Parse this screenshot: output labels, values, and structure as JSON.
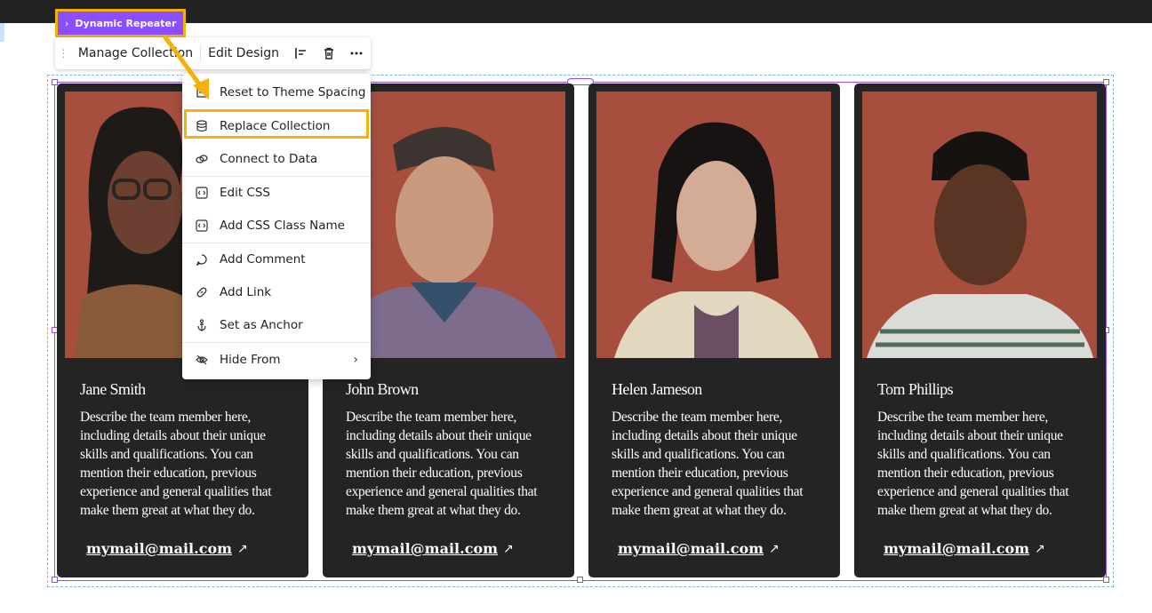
{
  "element_tag": {
    "label": "Dynamic Repeater",
    "chevron": "›"
  },
  "toolbar": {
    "manage_label": "Manage Collection",
    "edit_design_label": "Edit Design"
  },
  "menu": {
    "items": [
      {
        "label": "Reset to Theme Spacing",
        "icon": "spacing-icon"
      },
      {
        "label": "Replace Collection",
        "icon": "database-icon"
      },
      {
        "label": "Connect to Data",
        "icon": "link-data-icon"
      },
      {
        "label": "Edit CSS",
        "icon": "code-icon"
      },
      {
        "label": "Add CSS Class Name",
        "icon": "code-icon"
      },
      {
        "label": "Add Comment",
        "icon": "comment-icon"
      },
      {
        "label": "Add Link",
        "icon": "link-icon"
      },
      {
        "label": "Set as Anchor",
        "icon": "anchor-icon"
      },
      {
        "label": "Hide From",
        "icon": "hidden-eye-icon",
        "has_submenu": true
      }
    ],
    "highlighted_item": "Replace Collection"
  },
  "cards": [
    {
      "name": "Jane Smith",
      "description": "Describe the team member here, including details about their unique skills and qualifications. You can mention their education, previous experience and general qualities that make them great at what they do.",
      "email": "mymail@mail.com"
    },
    {
      "name": "John Brown",
      "description": "Describe the team member here, including details about their unique skills and qualifications. You can mention their education, previous experience and general qualities that make them great at what they do.",
      "email": "mymail@mail.com"
    },
    {
      "name": "Helen Jameson",
      "description": "Describe the team member here, including details about their unique skills and qualifications. You can mention their education, previous experience and general qualities that make them great at what they do.",
      "email": "mymail@mail.com"
    },
    {
      "name": "Tom Phillips",
      "description": "Describe the team member here, including details about their unique skills and qualifications. You can mention their education, previous experience and general qualities that make them great at what they do.",
      "email": "mymail@mail.com"
    }
  ],
  "colors": {
    "selection": "#8a4dff",
    "highlight": "#f4b00b",
    "card_bg": "#242424",
    "photo_bg": "#a74e3f"
  }
}
